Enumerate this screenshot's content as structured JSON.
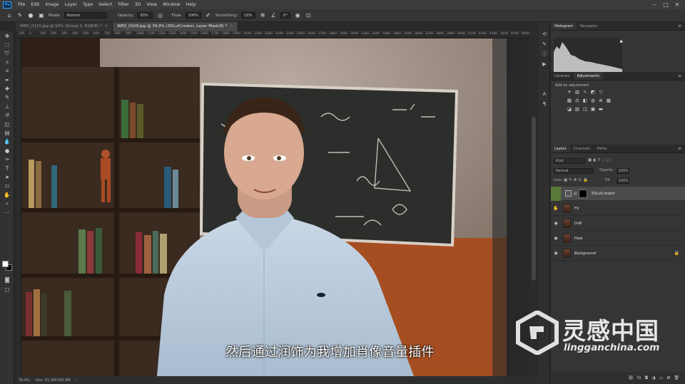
{
  "menubar": {
    "logo": "Ps",
    "items": [
      "File",
      "Edit",
      "Image",
      "Layer",
      "Type",
      "Select",
      "Filter",
      "3D",
      "View",
      "Window",
      "Help"
    ]
  },
  "options": {
    "mode_label": "Mode:",
    "mode_value": "Normal",
    "opacity_label": "Opacity:",
    "opacity_value": "50%",
    "flow_label": "Flow:",
    "flow_value": "100%",
    "smoothing_label": "Smoothing:",
    "smoothing_value": "10%",
    "angle_value": "0°"
  },
  "tabs": [
    {
      "label": "WED_0115.jpg @ 50% (Group 1, RGB/8) *",
      "active": false
    },
    {
      "label": "WED_0109.jpg @ 39,9% (3DLutCreator, Layer Mask/8) *",
      "active": true
    }
  ],
  "ruler_ticks": [
    "100",
    "0",
    "100",
    "200",
    "300",
    "400",
    "500",
    "600",
    "700",
    "800",
    "900",
    "1000",
    "1100",
    "1200",
    "1300",
    "1400",
    "1500",
    "1600",
    "1700",
    "1800",
    "1900",
    "2000",
    "2100",
    "2200",
    "2300",
    "2400",
    "2500",
    "2600",
    "2700",
    "2800",
    "2900",
    "3000",
    "3100",
    "3200",
    "3300",
    "3400",
    "3500",
    "3600",
    "3700",
    "3800",
    "3900",
    "4000",
    "4100",
    "4200",
    "4300",
    "4400",
    "4500",
    "4600",
    "4700"
  ],
  "status": {
    "zoom": "39.9%",
    "doc": "Doc: 61,3M/183,9M"
  },
  "panels": {
    "histogram_tab": "Histogram",
    "navigator_tab": "Navigator",
    "libraries_tab": "Libraries",
    "adjustments_tab": "Adjustments",
    "adjustment_label": "Add an adjustment",
    "layers_tab": "Layers",
    "channels_tab": "Channels",
    "paths_tab": "Paths",
    "kind_value": "Kind",
    "blend_value": "Normal",
    "opacity_label": "Opacity:",
    "opacity_value": "100%",
    "lock_label": "Lock:",
    "fill_label": "Fill:",
    "fill_value": "100%"
  },
  "layers": [
    {
      "name": "3DLutCreator",
      "selected": true,
      "type": "adjustment",
      "visible": false
    },
    {
      "name": "FV",
      "selected": false,
      "type": "photo",
      "visible": true
    },
    {
      "name": "DnB",
      "selected": false,
      "type": "photo",
      "visible": true
    },
    {
      "name": "Heal",
      "selected": false,
      "type": "photo",
      "visible": true
    },
    {
      "name": "Background",
      "selected": false,
      "type": "photo",
      "visible": true,
      "locked": true
    }
  ],
  "subtitle": "然后通过润饰为我增加肖像音量插件",
  "watermark": {
    "title": "灵感中国",
    "url": "lingganchina.com"
  },
  "colors": {
    "ui_dark": "#282828",
    "panel": "#353535",
    "accent": "#31a8ff",
    "foreground_swatch": "#ffffff",
    "background_swatch": "#000000"
  }
}
